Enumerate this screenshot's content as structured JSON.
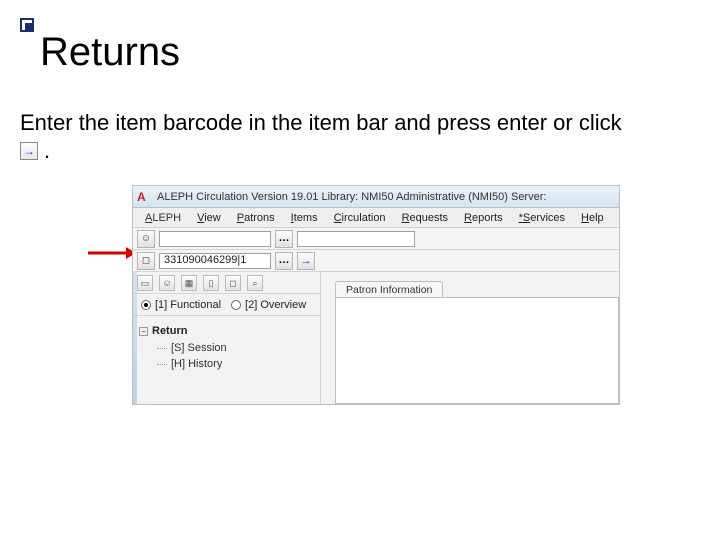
{
  "slide": {
    "title": "Returns",
    "instruction_part1": "Enter the item barcode in the item bar and press enter or click",
    "instruction_period": "."
  },
  "app_window": {
    "title": "ALEPH Circulation   Version 19.01  Library: NMI50   Administrative (NMI50)   Server:",
    "menu": [
      "ALEPH",
      "View",
      "Patrons",
      "Items",
      "Circulation",
      "Requests",
      "Reports",
      "*Services",
      "Help"
    ],
    "toolbar_row1": {
      "input1_value": "",
      "input2_value": ""
    },
    "toolbar_row2": {
      "barcode_value": "331090046299|1"
    },
    "radio": {
      "option1": "[1] Functional",
      "option1_checked": true,
      "option2": "[2] Overview",
      "option2_checked": false
    },
    "tree": {
      "root_label": "Return",
      "children": [
        "[S] Session",
        "[H] History"
      ]
    },
    "right_tab": "Patron Information"
  },
  "icons": {
    "go_arrow": "→",
    "doc": "▭",
    "page": "◻",
    "person": "☺",
    "calendar": "▦",
    "card": "▯",
    "find": "⌕",
    "binoc": "⌕",
    "minus": "−"
  }
}
